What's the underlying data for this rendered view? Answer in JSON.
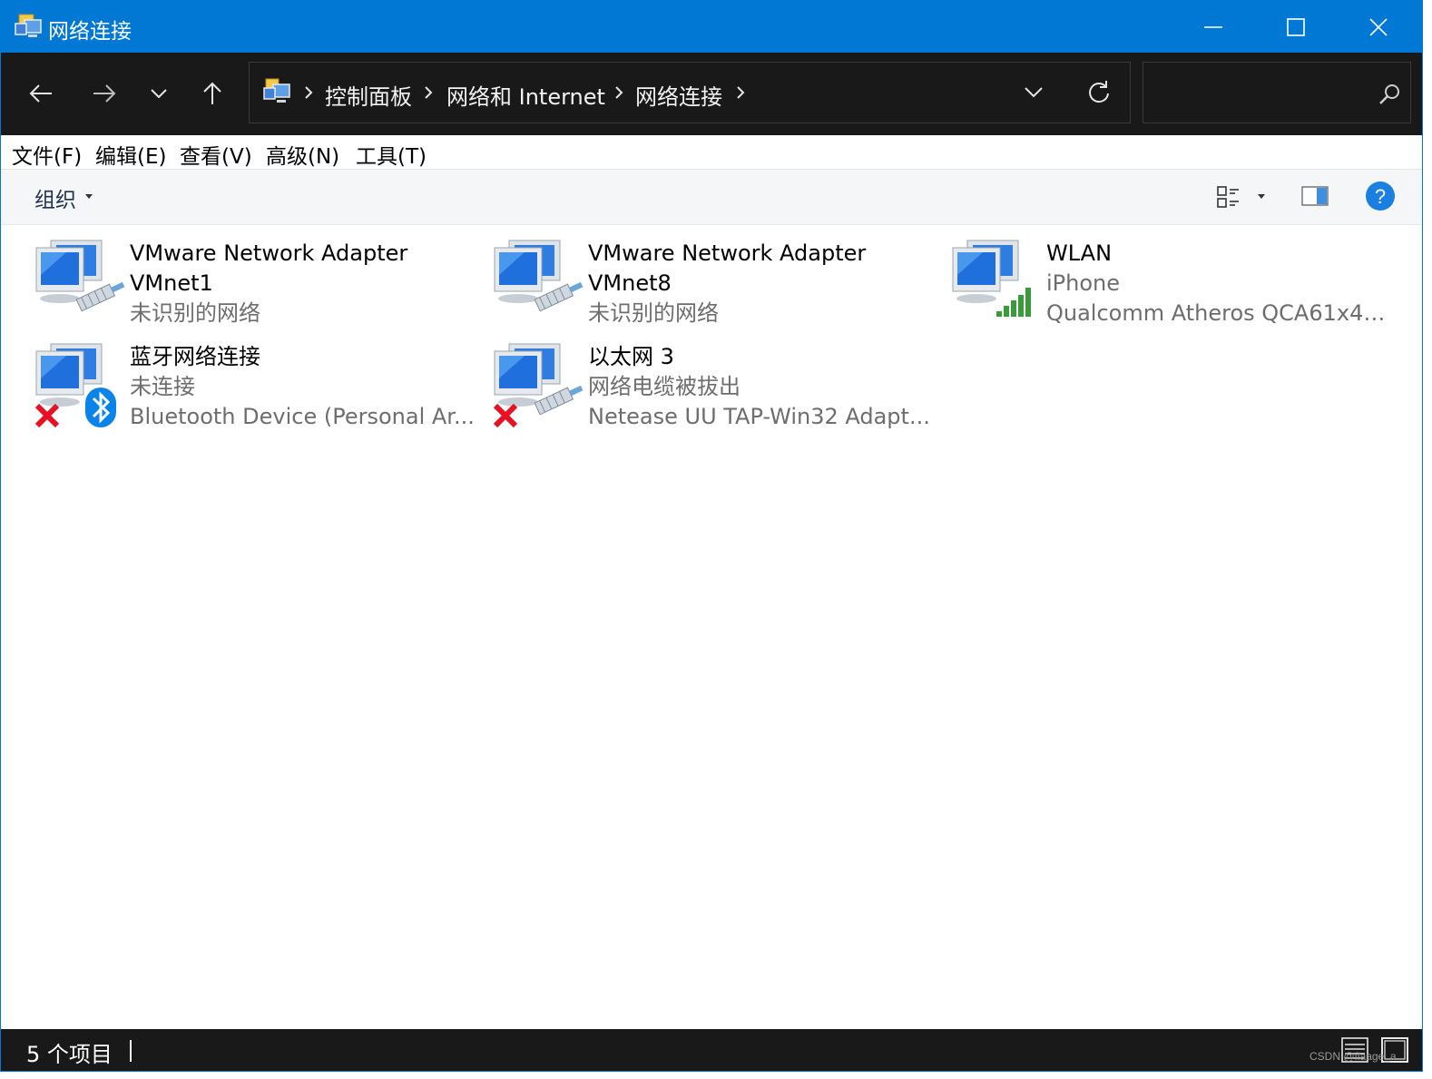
{
  "window": {
    "title": "网络连接",
    "title_icon": "network-connections-icon",
    "controls": [
      "minimize-icon",
      "maximize-icon",
      "close-icon"
    ]
  },
  "nav": {
    "buttons": [
      "back-arrow-icon",
      "forward-arrow-icon",
      "recent-dropdown-icon",
      "up-arrow-icon"
    ],
    "breadcrumbs": [
      "控制面板",
      "网络和 Internet",
      "网络连接"
    ],
    "search_placeholder": ""
  },
  "menu": {
    "items": [
      "文件(F)",
      "编辑(E)",
      "查看(V)",
      "高级(N)",
      "工具(T)"
    ]
  },
  "toolbar": {
    "organize_label": "组织"
  },
  "connections": [
    {
      "name_line1": "VMware Network Adapter",
      "name_line2": "VMnet1",
      "status": "未识别的网络",
      "icon": "ethernet-adapter-icon",
      "overlay": "none"
    },
    {
      "name_line1": "VMware Network Adapter",
      "name_line2": "VMnet8",
      "status": "未识别的网络",
      "icon": "ethernet-adapter-icon",
      "overlay": "none"
    },
    {
      "name_line1": "WLAN",
      "name_line2": "iPhone",
      "status": "Qualcomm Atheros QCA61x4A...",
      "icon": "wifi-adapter-icon",
      "overlay": "signal-bars"
    },
    {
      "name_line1": "蓝牙网络连接",
      "name_line2": "未连接",
      "status": "Bluetooth Device (Personal Ar...",
      "icon": "bluetooth-adapter-icon",
      "overlay": "disconnected-x"
    },
    {
      "name_line1": "以太网 3",
      "name_line2": "网络电缆被拔出",
      "status": "Netease UU TAP-Win32 Adapt...",
      "icon": "ethernet-adapter-icon",
      "overlay": "disconnected-x"
    }
  ],
  "status_bar": {
    "item_count": "5 个项目",
    "watermark": "CSDN @flaage_a"
  },
  "colors": {
    "accent": "#0078d4",
    "dark_bar": "#191919",
    "secondary_text": "#6d6d6d",
    "error_red": "#e81123",
    "bluetooth_blue": "#0a84e8",
    "signal_green": "#3a9b3a"
  }
}
